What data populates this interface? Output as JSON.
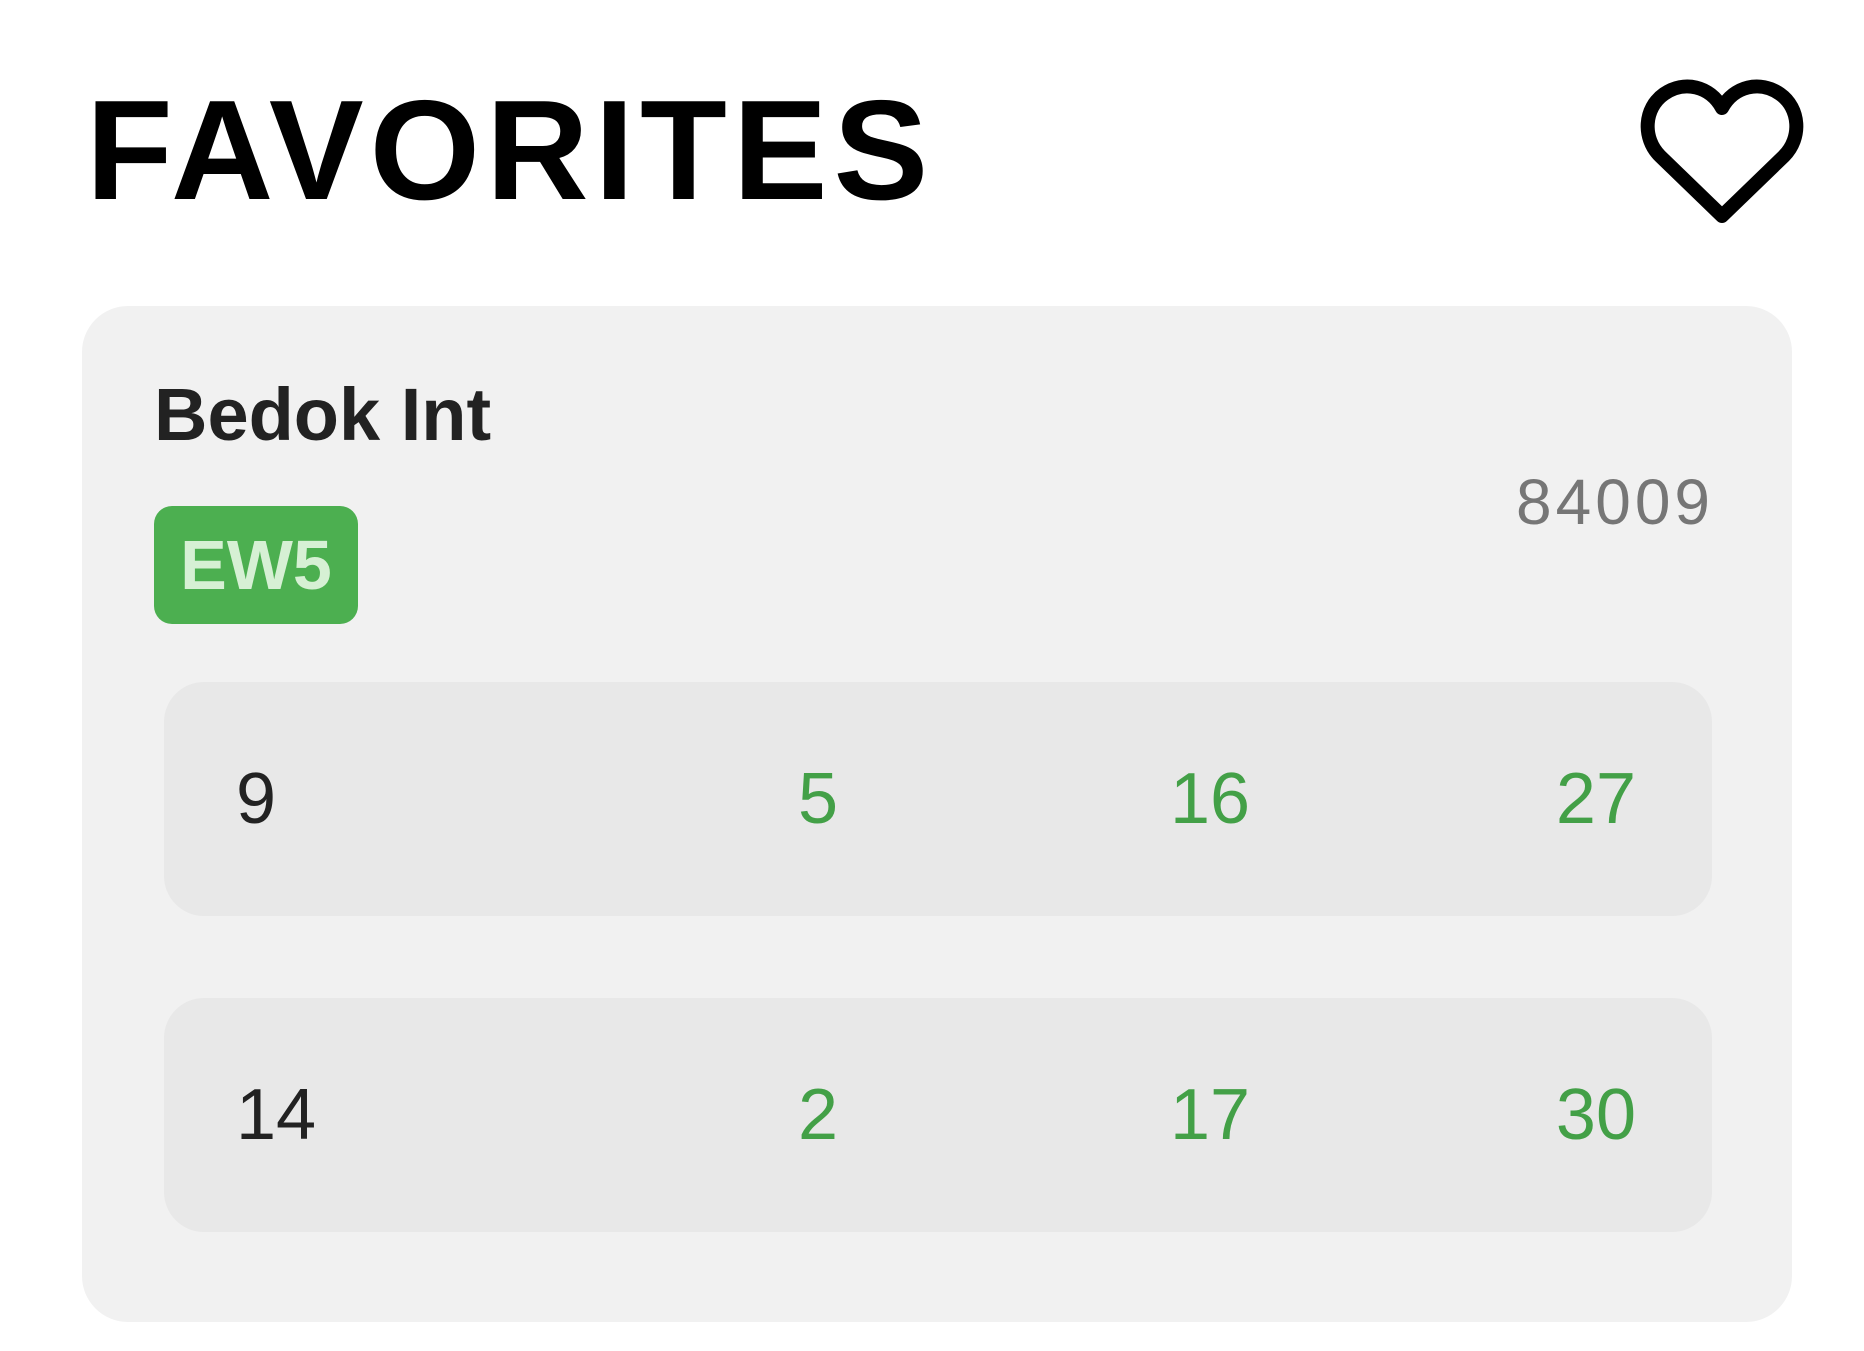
{
  "header": {
    "title": "FAVORITES",
    "favorite_icon": "heart-outline-icon"
  },
  "stop": {
    "name": "Bedok Int",
    "code": "84009",
    "mrt_badge": "EW5",
    "badge_color": "#4caf50",
    "arrivals": [
      {
        "service": "9",
        "times": [
          "5",
          "16",
          "27"
        ]
      },
      {
        "service": "14",
        "times": [
          "2",
          "17",
          "30"
        ]
      }
    ]
  },
  "colors": {
    "arrival_time": "#43a047",
    "card_bg": "#f1f1f1",
    "row_bg": "#e8e8e8"
  }
}
